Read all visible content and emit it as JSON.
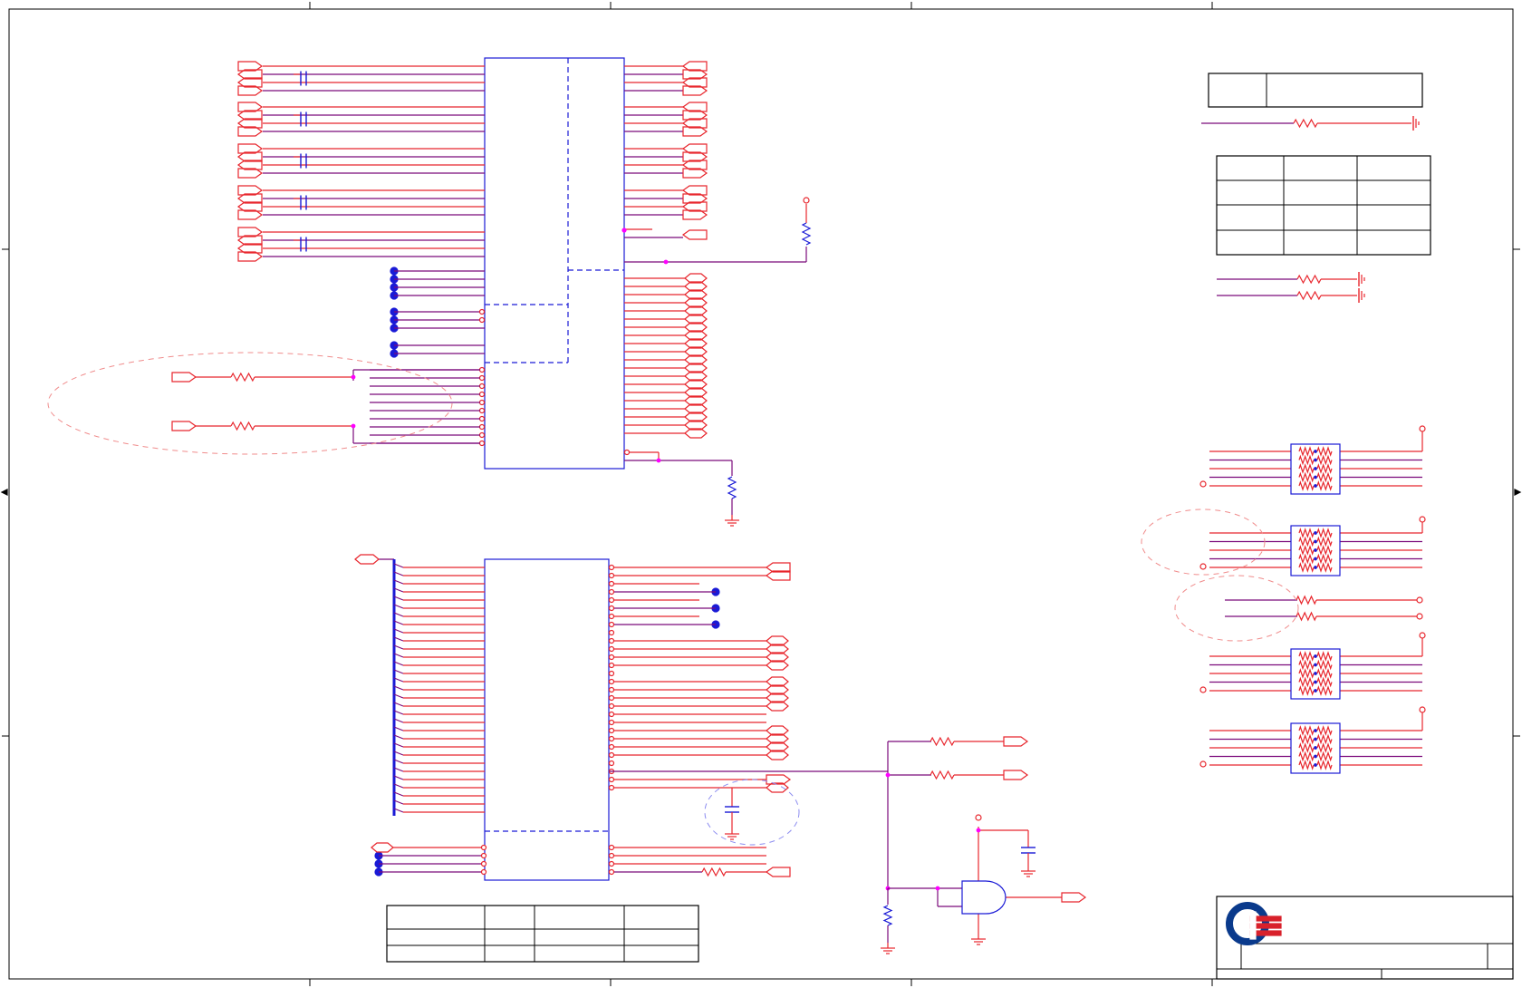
{
  "sheet": {
    "title": "",
    "revision": "",
    "sheet_number": ""
  },
  "colors": {
    "wire_red": "#e8262d",
    "bus_purple": "#7b0a7b",
    "component_blue": "#1a1ad6",
    "junction_magenta": "#ff00ff",
    "annotation_dash": "#f08c8c",
    "frame_black": "#000000",
    "logo_blue": "#0a3a8c",
    "logo_red": "#d8202a"
  },
  "icons": {
    "logo": "company-logo-icon",
    "ground": "ground-icon",
    "resistor": "resistor-icon",
    "capacitor": "capacitor-icon",
    "and_gate": "and-gate-icon",
    "off_page_connector": "port-connector-icon"
  }
}
